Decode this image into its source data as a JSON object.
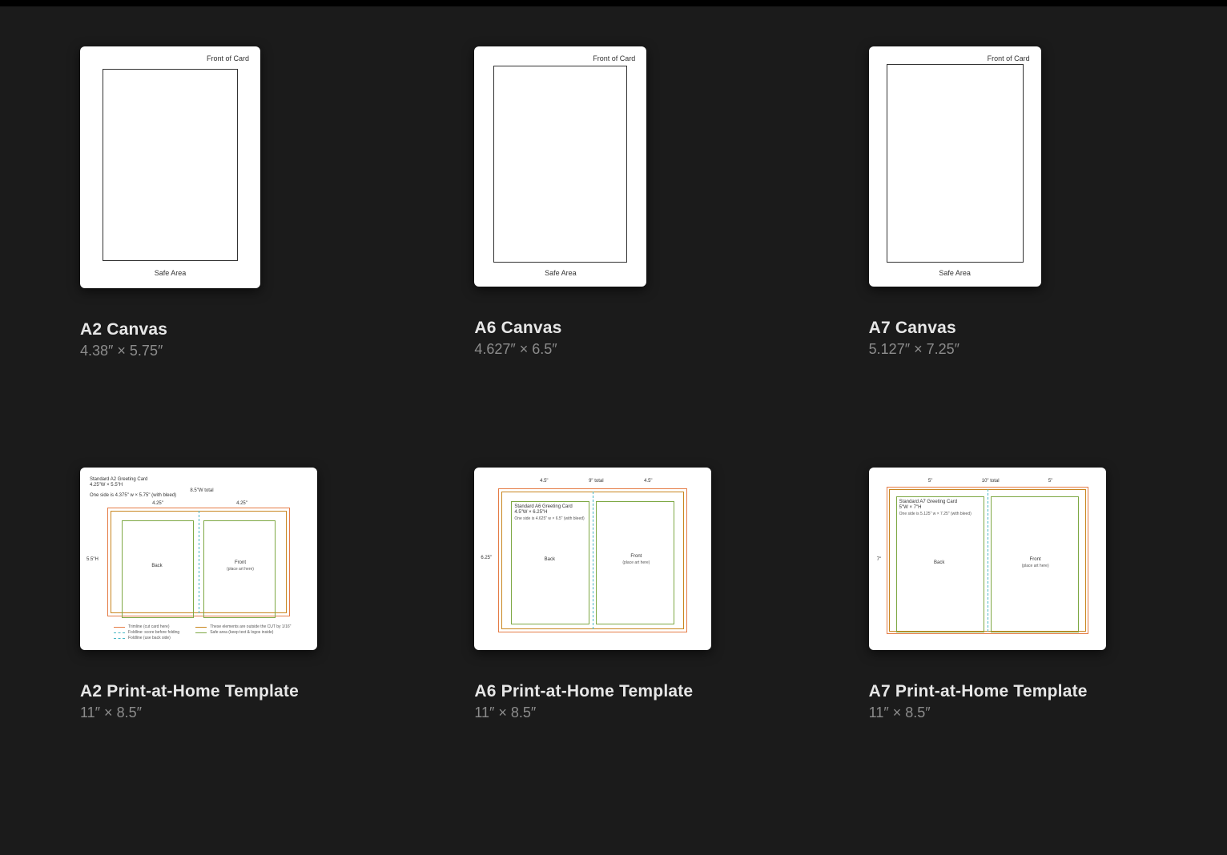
{
  "templates": [
    {
      "key": "a2_canvas",
      "title": "A2 Canvas",
      "subtitle": "4.38″ × 5.75″",
      "canvas": {
        "front_label": "Front of Card",
        "safe_label": "Safe Area"
      }
    },
    {
      "key": "a6_canvas",
      "title": "A6 Canvas",
      "subtitle": "4.627″ × 6.5″",
      "canvas": {
        "front_label": "Front of Card",
        "safe_label": "Safe Area"
      }
    },
    {
      "key": "a7_canvas",
      "title": "A7 Canvas",
      "subtitle": "5.127″ × 7.25″",
      "canvas": {
        "front_label": "Front of Card",
        "safe_label": "Safe Area"
      }
    },
    {
      "key": "a2_print",
      "title": "A2 Print-at-Home Template",
      "subtitle": "11″ × 8.5″",
      "sheet": {
        "header1": "Standard A2 Greeting Card",
        "header2": "4.25\"W × 5.5\"H",
        "header3": "One side is 4.375\" w × 5.75\" (with bleed)",
        "top_total": "8.5\"W total",
        "top_left": "4.25\"",
        "top_right": "4.25\"",
        "side_h": "5.5\"H",
        "back": "Back",
        "front": "Front",
        "front_sub": "(place art here)",
        "legend": [
          "Trimline (cut card here)",
          "Foldline: score before folding",
          "Foldline (use back side)",
          "These elements are outside the CUT by 1/16\"",
          "Safe area (keep text & logos inside)"
        ]
      }
    },
    {
      "key": "a6_print",
      "title": "A6 Print-at-Home Template",
      "subtitle": "11″ × 8.5″",
      "sheet": {
        "header1": "Standard A6 Greeting Card",
        "header2": "4.5\"W × 6.25\"H",
        "header3": "One side is 4.625\" w × 6.5\" (with bleed)",
        "top_total": "9\" total",
        "top_left": "4.5\"",
        "top_right": "4.5\"",
        "side_h": "6.25\"",
        "back": "Back",
        "front": "Front",
        "front_sub": "(place art here)"
      }
    },
    {
      "key": "a7_print",
      "title": "A7 Print-at-Home Template",
      "subtitle": "11″ × 8.5″",
      "sheet": {
        "header1": "Standard A7 Greeting Card",
        "header2": "5\"W × 7\"H",
        "header3": "One side is 5.125\" w × 7.25\" (with bleed)",
        "top_total": "10\" total",
        "top_left": "5\"",
        "top_right": "5\"",
        "side_h": "7\"",
        "back": "Back",
        "front": "Front",
        "front_sub": "(place art here)"
      }
    }
  ]
}
